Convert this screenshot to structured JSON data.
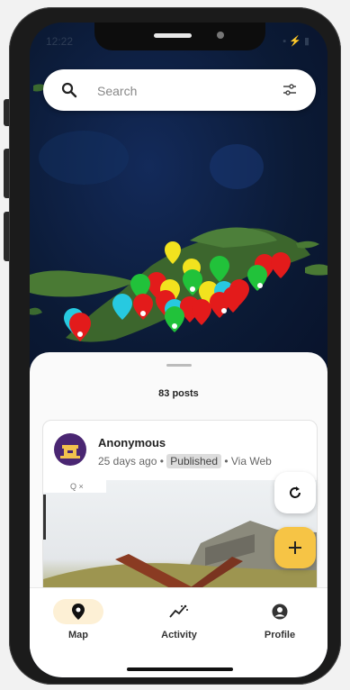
{
  "status": {
    "time": "12:22",
    "icons": "▪ ⚡ ▮"
  },
  "search": {
    "placeholder": "Search"
  },
  "icons": {
    "search": "search-icon",
    "filter": "filter-icon",
    "refresh": "refresh-icon",
    "add": "plus-icon",
    "map": "map-pin-icon",
    "activity": "activity-icon",
    "profile": "profile-icon"
  },
  "sheet": {
    "posts_count": "83 posts"
  },
  "post": {
    "author": "Anonymous",
    "age": "25 days ago",
    "status": "Published",
    "via": "Via Web",
    "photo_toolbar": "Q  ×"
  },
  "nav": {
    "map_label": "Map",
    "activity_label": "Activity",
    "profile_label": "Profile"
  },
  "colors": {
    "accent": "#f6c445",
    "nav_active_bg": "#fdf0d5",
    "pin_red": "#e31b1b",
    "pin_green": "#21c23a",
    "pin_yellow": "#f2e21e",
    "pin_cyan": "#27c9e0"
  }
}
